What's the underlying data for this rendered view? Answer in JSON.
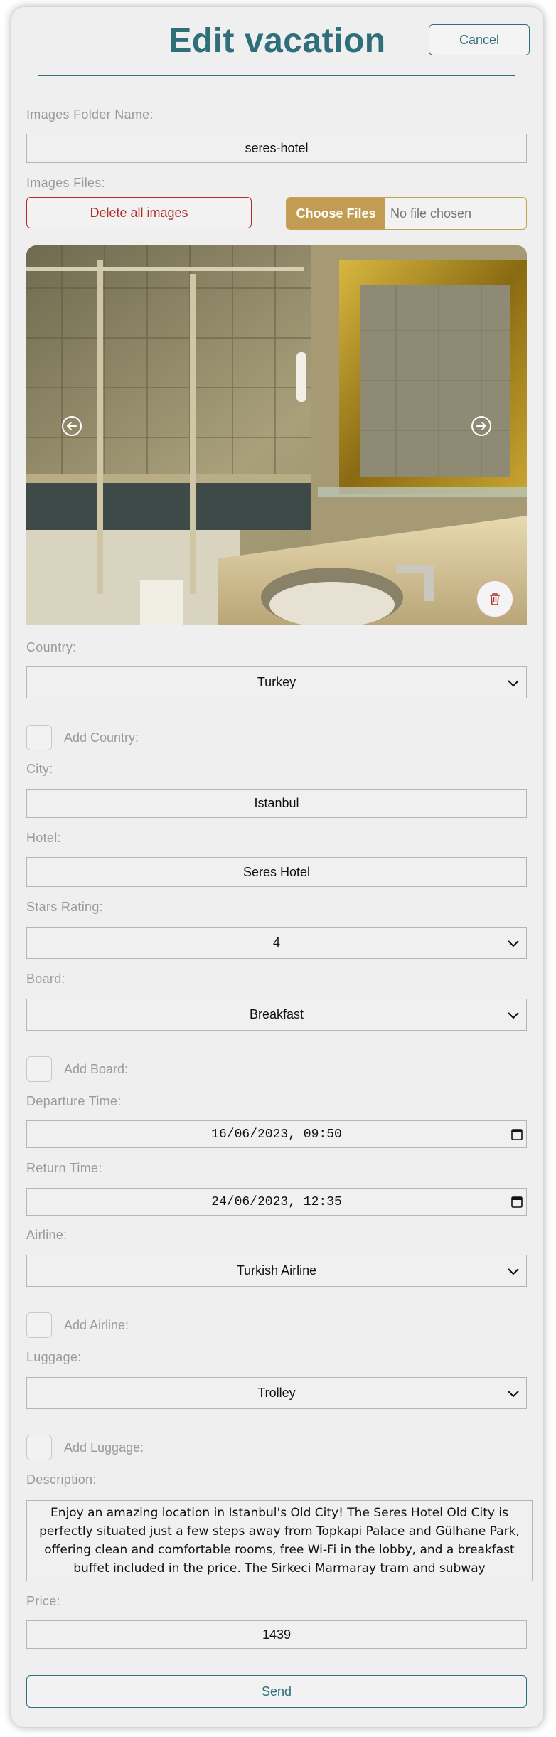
{
  "header": {
    "title": "Edit vacation",
    "cancel_label": "Cancel"
  },
  "images": {
    "folder_label": "Images Folder Name:",
    "folder_value": "seres-hotel",
    "files_label": "Images Files:",
    "delete_all_label": "Delete all images",
    "choose_files_label": "Choose Files",
    "no_file_label": "No file chosen"
  },
  "country": {
    "label": "Country:",
    "value": "Turkey",
    "add_label": "Add Country:"
  },
  "city": {
    "label": "City:",
    "value": "Istanbul"
  },
  "hotel": {
    "label": "Hotel:",
    "value": "Seres Hotel"
  },
  "stars": {
    "label": "Stars Rating:",
    "value": "4"
  },
  "board": {
    "label": "Board:",
    "value": "Breakfast",
    "add_label": "Add Board:"
  },
  "departure": {
    "label": "Departure Time:",
    "value": "16/06/2023, 09:50"
  },
  "return": {
    "label": "Return Time:",
    "value": "24/06/2023, 12:35"
  },
  "airline": {
    "label": "Airline:",
    "value": "Turkish Airline",
    "add_label": "Add Airline:"
  },
  "luggage": {
    "label": "Luggage:",
    "value": "Trolley",
    "add_label": "Add Luggage:"
  },
  "description": {
    "label": "Description:",
    "value": "Enjoy an amazing location in Istanbul's Old City! The Seres Hotel Old City is perfectly situated just a few steps away from Topkapi Palace and Gülhane Park, offering clean and comfortable rooms, free Wi-Fi in the lobby, and a breakfast buffet included in the price. The Sirkeci Marmaray tram and subway"
  },
  "price": {
    "label": "Price:",
    "value": "1439"
  },
  "send_label": "Send",
  "colors": {
    "accent": "#2e6f7a",
    "danger": "#b32c2c",
    "gold": "#c29c52",
    "card": "#efefef"
  },
  "icons": [
    "chevron-down-icon",
    "calendar-icon",
    "arrow-left-icon",
    "arrow-right-icon",
    "trash-icon"
  ]
}
